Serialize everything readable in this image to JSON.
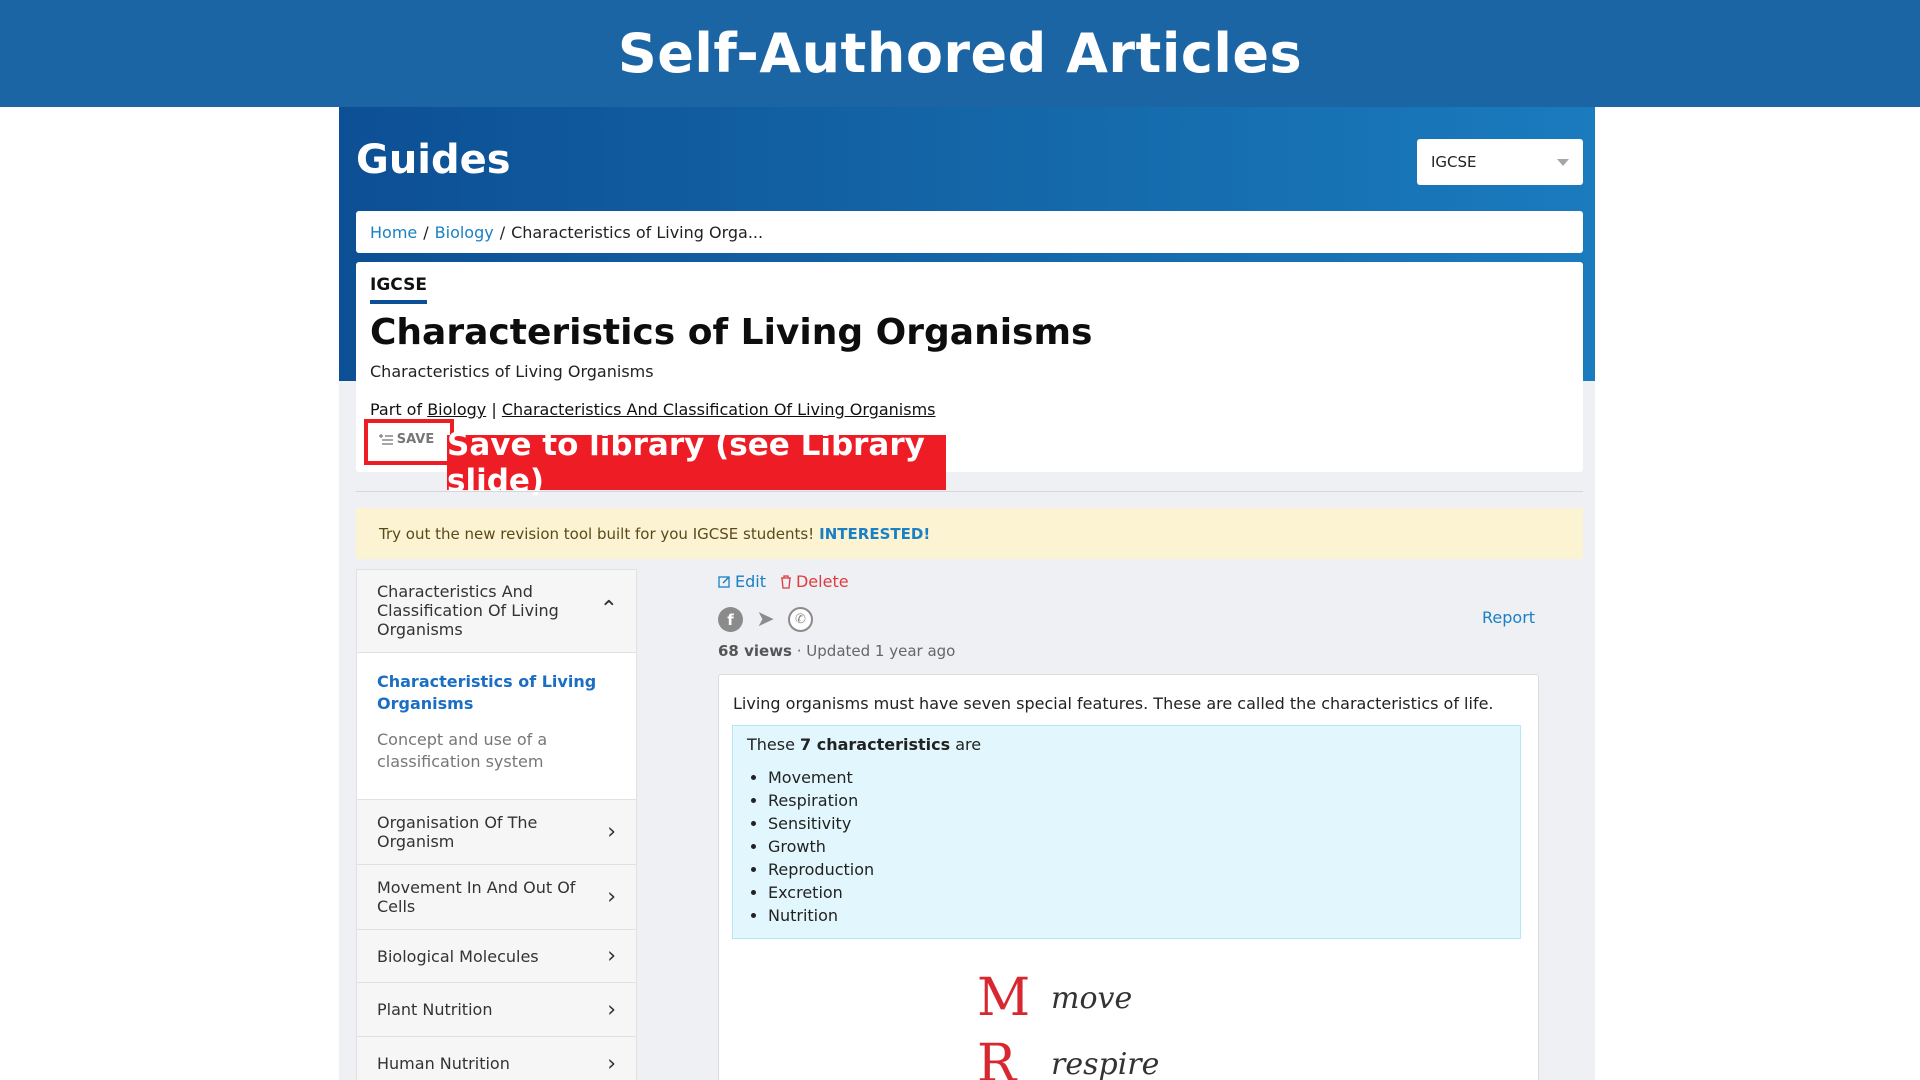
{
  "banner": {
    "title": "Self-Authored Articles"
  },
  "header": {
    "title": "Guides",
    "level_select": "IGCSE"
  },
  "breadcrumb": {
    "home": "Home",
    "subject": "Biology",
    "current": "Characteristics of Living Orga..."
  },
  "article": {
    "badge": "IGCSE",
    "title": "Characteristics of Living Organisms",
    "subtitle": "Characteristics of Living Organisms",
    "part_of_prefix": "Part of",
    "part_of_subject": "Biology",
    "part_of_divider": "|",
    "part_of_topic": "Characteristics And Classification Of Living Organisms",
    "save_label": "SAVE"
  },
  "callout": {
    "text": "Save to library (see Library slide)",
    "color": "#ee1c25"
  },
  "promo": {
    "text": "Try out the new revision tool built for you IGCSE students!",
    "link": "INTERESTED!"
  },
  "sidebar": {
    "open_section": "Characteristics And Classification Of Living Organisms",
    "active_item": "Characteristics of Living Organisms",
    "sub_item": "Concept and use of a classification system",
    "sections": [
      "Organisation Of The Organism",
      "Movement In And Out Of Cells",
      "Biological Molecules",
      "Plant Nutrition",
      "Human Nutrition"
    ]
  },
  "actions": {
    "edit": "Edit",
    "delete": "Delete",
    "report": "Report"
  },
  "stats": {
    "views": "68 views",
    "updated": "· Updated 1 year ago"
  },
  "content": {
    "intro": "Living organisms must have seven special features. These are called the characteristics of life.",
    "lead_prefix": "These",
    "lead_bold": "7 characteristics",
    "lead_suffix": "are",
    "characteristics": [
      "Movement",
      "Respiration",
      "Sensitivity",
      "Growth",
      "Reproduction",
      "Excretion",
      "Nutrition"
    ],
    "mnemonic": [
      {
        "letter": "M",
        "word": "move"
      },
      {
        "letter": "R",
        "word": "respire"
      }
    ]
  },
  "colors": {
    "banner": "#1b65a5",
    "link": "#1a80c4",
    "delete": "#e0393e",
    "info_bg": "#e1f7fd",
    "promo_bg": "#fcf3d2"
  }
}
